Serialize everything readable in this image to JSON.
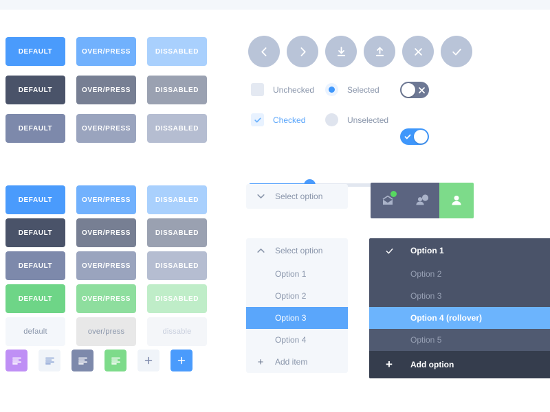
{
  "theme": {
    "blue": "#4a9bfc",
    "blue_hover": "#71b1fd",
    "blue_disabled": "#a9d0fd",
    "slate_dark": "#4a5369",
    "slate_mid": "#777f93",
    "slate_light": "#9aa1b1",
    "periwinkle": "#7d89ab",
    "periwinkle_hover": "#9aa4be",
    "periwinkle_light": "#b5bdd1",
    "green": "#6ed587",
    "green_hover": "#8ede9e",
    "green_disabled": "#bfedc8",
    "ghost_bg": "#f4f7fb",
    "ghost_hover_bg": "#e8e8e8",
    "ghost_disabled_bg": "#f4f6f9",
    "purple": "#bf8ff5",
    "top_band": "#f4f7fb"
  },
  "buttons_primary": {
    "rows": [
      {
        "name": "blue",
        "cells": [
          {
            "label": "DEFAULT",
            "bg": "#4a9bfc",
            "fg": "#ffffff"
          },
          {
            "label": "OVER/PRESS",
            "bg": "#71b1fd",
            "fg": "#ffffff"
          },
          {
            "label": "DISSABLED",
            "bg": "#a9d0fd",
            "fg": "#ffffff"
          }
        ]
      },
      {
        "name": "slate",
        "cells": [
          {
            "label": "DEFAULT",
            "bg": "#4a5369",
            "fg": "#ffffff"
          },
          {
            "label": "OVER/PRESS",
            "bg": "#777f93",
            "fg": "#ffffff"
          },
          {
            "label": "DISSABLED",
            "bg": "#9aa1b1",
            "fg": "#ffffff"
          }
        ]
      },
      {
        "name": "periwinkle",
        "cells": [
          {
            "label": "DEFAULT",
            "bg": "#7d89ab",
            "fg": "#ffffff"
          },
          {
            "label": "OVER/PRESS",
            "bg": "#9aa4be",
            "fg": "#ffffff"
          },
          {
            "label": "DISSABLED",
            "bg": "#b5bdd1",
            "fg": "#ffffff"
          }
        ]
      }
    ]
  },
  "buttons_secondary": {
    "rows": [
      {
        "name": "blue",
        "cells": [
          {
            "label": "DEFAULT",
            "bg": "#4a9bfc",
            "fg": "#ffffff"
          },
          {
            "label": "OVER/PRESS",
            "bg": "#71b1fd",
            "fg": "#ffffff"
          },
          {
            "label": "DISSABLED",
            "bg": "#a9d0fd",
            "fg": "#ffffff"
          }
        ]
      },
      {
        "name": "slate",
        "cells": [
          {
            "label": "DEFAULT",
            "bg": "#4a5369",
            "fg": "#ffffff"
          },
          {
            "label": "OVER/PRESS",
            "bg": "#777f93",
            "fg": "#ffffff"
          },
          {
            "label": "DISSABLED",
            "bg": "#9aa1b1",
            "fg": "#ffffff"
          }
        ]
      },
      {
        "name": "periwinkle",
        "cells": [
          {
            "label": "DEFAULT",
            "bg": "#7d89ab",
            "fg": "#ffffff"
          },
          {
            "label": "OVER/PRESS",
            "bg": "#9aa4be",
            "fg": "#ffffff"
          },
          {
            "label": "DISSABLED",
            "bg": "#b5bdd1",
            "fg": "#ffffff"
          }
        ]
      },
      {
        "name": "green",
        "cells": [
          {
            "label": "DEFAULT",
            "bg": "#6ed587",
            "fg": "#ffffff"
          },
          {
            "label": "OVER/PRESS",
            "bg": "#8ede9e",
            "fg": "#ffffff"
          },
          {
            "label": "DISSABLED",
            "bg": "#bfedc8",
            "fg": "#ffffff"
          }
        ]
      },
      {
        "name": "ghost",
        "lowercase": true,
        "cells": [
          {
            "label": "default",
            "bg": "#f4f7fb",
            "fg": "#8a96ab"
          },
          {
            "label": "over/press",
            "bg": "#e8e8e8",
            "fg": "#8a96ab"
          },
          {
            "label": "dissable",
            "bg": "#f4f6f9",
            "fg": "#c7cedd"
          }
        ]
      }
    ]
  },
  "icon_square_buttons": [
    {
      "icon": "align-left-icon",
      "bg": "#bf8ff5",
      "fg": "#ffffff"
    },
    {
      "icon": "align-left-icon",
      "bg": "#f0f4f9",
      "fg": "#8fa7d6"
    },
    {
      "icon": "align-left-icon",
      "bg": "#7d89ab",
      "fg": "#ffffff"
    },
    {
      "icon": "align-left-icon",
      "bg": "#7ddb8a",
      "fg": "#ffffff"
    },
    {
      "icon": "plus-icon",
      "bg": "#f0f4f9",
      "fg": "#7d89ab"
    },
    {
      "icon": "plus-icon",
      "bg": "#4a9bfc",
      "fg": "#ffffff"
    }
  ],
  "circle_buttons": [
    {
      "icon": "chevron-left-icon",
      "name": "back-button"
    },
    {
      "icon": "chevron-right-icon",
      "name": "forward-button"
    },
    {
      "icon": "download-icon",
      "name": "download-button"
    },
    {
      "icon": "upload-icon",
      "name": "upload-button"
    },
    {
      "icon": "close-icon",
      "name": "close-button"
    },
    {
      "icon": "check-icon",
      "name": "confirm-button"
    }
  ],
  "checkboxes": [
    {
      "label": "Unchecked",
      "checked": false
    },
    {
      "label": "Checked",
      "checked": true
    }
  ],
  "radios": [
    {
      "label": "Selected",
      "selected": true
    },
    {
      "label": "Unselected",
      "selected": false
    }
  ],
  "toggles": [
    {
      "state": "off",
      "glyph": "✕"
    },
    {
      "state": "on",
      "glyph": "✓"
    }
  ],
  "slider": {
    "value_percent": 38,
    "min": 0,
    "max": 100
  },
  "select_collapsed": {
    "caret": "chevron-down-icon",
    "label": "Select option"
  },
  "select_expanded": {
    "caret": "chevron-up-icon",
    "label": "Select option",
    "options": [
      {
        "label": "Option 1",
        "selected": false
      },
      {
        "label": "Option 2",
        "selected": false
      },
      {
        "label": "Option 3",
        "selected": true
      },
      {
        "label": "Option 4",
        "selected": false
      }
    ],
    "add_label": "Add item",
    "add_icon": "plus-icon"
  },
  "segmented_tabs": [
    {
      "icon": "mail-icon",
      "active": false,
      "badge": true
    },
    {
      "icon": "contacts-icon",
      "active": false,
      "badge": false
    },
    {
      "icon": "person-icon",
      "active": true,
      "badge": false
    }
  ],
  "dark_select": {
    "rows": [
      {
        "label": "Option 1",
        "style": "first",
        "icon": "check-icon"
      },
      {
        "label": "Option 2",
        "style": "plain",
        "icon": ""
      },
      {
        "label": "Option 3",
        "style": "plain",
        "icon": ""
      },
      {
        "label": "Option 4 (rollover)",
        "style": "roll",
        "icon": ""
      },
      {
        "label": "Option 5",
        "style": "alt",
        "icon": ""
      }
    ],
    "add_label": "Add option",
    "add_icon": "plus-icon"
  }
}
